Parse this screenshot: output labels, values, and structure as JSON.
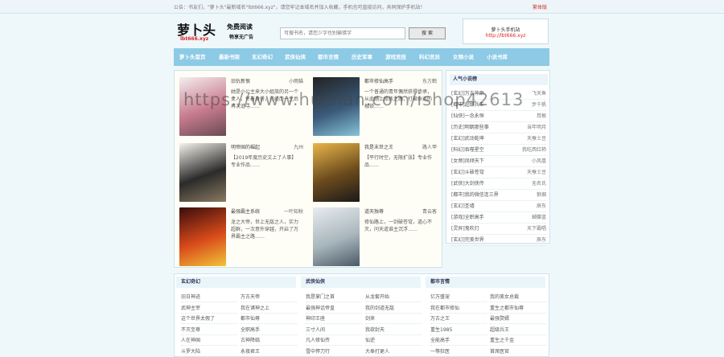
{
  "topbar": {
    "notice": "公告：书友们，\"萝卜头\"最新域名\"lbt666.xyz\"，请您牢记本域名并加入收藏，手机也可直接访问，共同保护手机站！",
    "trad_link": "繁体版"
  },
  "header": {
    "logo": "萝卜头",
    "logo_sub": "lbt666.xyz",
    "slogan_line1": "免费阅读",
    "slogan_line2": "畅享无广告",
    "search_placeholder": "可搜书名，请您少字也别输错字",
    "search_button": "搜 索",
    "mobile_line1": "萝卜头手机站",
    "mobile_line2": "http://lbt666.xyz"
  },
  "nav": [
    "萝卜头首页",
    "最新书架",
    "玄幻奇幻",
    "武侠仙侠",
    "都市言情",
    "历史军事",
    "游戏竞技",
    "科幻灵异",
    "女频小说",
    "小说书库"
  ],
  "books": [
    {
      "title": "旧仇新恨",
      "author": "小雨猫",
      "desc": "她是小公主来大小姐族的另一个女人，怀着身份，在经历一生后再次追寻……",
      "cover": [
        "#f4eef0",
        "#c77b8e",
        "#6a4a55"
      ]
    },
    {
      "title": "都市修仙高手",
      "author": "东方鹤",
      "desc": "一个普通的青年偶然获得传承，从此踏上修炼之路，打破命运的枷锁……",
      "cover": [
        "#222",
        "#3a5a7a",
        "#87c4d8"
      ]
    },
    {
      "title": "明帝国的崛起",
      "author": "九州",
      "desc": "【2019年度历史文上了人事】专业作品……",
      "cover": [
        "#f6f3ec",
        "#2b2b2b",
        "#8a7a60"
      ]
    },
    {
      "title": "我是末世之王",
      "author": "路人甲",
      "desc": "【平行时空，无限扩张】专业作品……",
      "cover": [
        "#e9b64a",
        "#6b4a1c",
        "#1a1a1a"
      ]
    },
    {
      "title": "最强霸主系统",
      "author": "一叶知秋",
      "desc": "龙之大帝，世上无敌之人，实力超群，一次意外穿越，开启了万界霸主之路……",
      "cover": [
        "#3a0c0c",
        "#d94b1a",
        "#f0c43a"
      ]
    },
    {
      "title": "道天独尊",
      "author": "青云客",
      "desc": "修仙路上，一剑破苍穹，道心不灭，问天道谁主沉浮……",
      "cover": [
        "#e8ecef",
        "#a9b6bd",
        "#4a5a66"
      ]
    }
  ],
  "sidebar": {
    "title": "人气小说榜",
    "items": [
      {
        "cat": "[玄幻]",
        "name": "万古神帝",
        "author": "飞天鱼"
      },
      {
        "cat": "[都市]",
        "name": "超级兵王",
        "author": "步千帆"
      },
      {
        "cat": "[仙侠]",
        "name": "一念永恒",
        "author": "耳根"
      },
      {
        "cat": "[历史]",
        "name": "明朝那些事",
        "author": "当年明月"
      },
      {
        "cat": "[玄幻]",
        "name": "武动乾坤",
        "author": "天蚕土豆"
      },
      {
        "cat": "[科幻]",
        "name": "吞噬星空",
        "author": "我吃西红柿"
      },
      {
        "cat": "[女频]",
        "name": "凤倾天下",
        "author": "小凤凰"
      },
      {
        "cat": "[玄幻]",
        "name": "斗破苍穹",
        "author": "天蚕土豆"
      },
      {
        "cat": "[武侠]",
        "name": "大剑侠传",
        "author": "无名氏"
      },
      {
        "cat": "[都市]",
        "name": "我的微信连三界",
        "author": "狼烟"
      },
      {
        "cat": "[玄幻]",
        "name": "圣墟",
        "author": "辰东"
      },
      {
        "cat": "[游戏]",
        "name": "全职高手",
        "author": "蝴蝶蓝"
      },
      {
        "cat": "[灵异]",
        "name": "鬼吹灯",
        "author": "天下霸唱"
      },
      {
        "cat": "[玄幻]",
        "name": "完美世界",
        "author": "辰东"
      }
    ]
  },
  "columns": [
    {
      "title": "玄幻奇幻",
      "rows": [
        [
          "旧日神迹",
          "万古天帝"
        ],
        [
          "武神主宰",
          "我在诸神之上"
        ],
        [
          "这个世界太假了",
          "都市仙尊"
        ],
        [
          "不灭至尊",
          "全职高手"
        ],
        [
          "人在神国",
          "古神降临"
        ],
        [
          "斗罗大陆",
          "永夜君王"
        ]
      ]
    },
    {
      "title": "武侠仙侠",
      "rows": [
        [
          "我是掌门之首",
          "从龙套开始"
        ],
        [
          "最强神话帝皇",
          "我的剑道无敌"
        ],
        [
          "神印王座",
          "剑来"
        ],
        [
          "三寸人间",
          "我欲封天"
        ],
        [
          "凡人修仙传",
          "仙逆"
        ],
        [
          "雪中悍刀行",
          "大奉打更人"
        ]
      ]
    },
    {
      "title": "都市言情",
      "rows": [
        [
          "亿万盛宠",
          "我的美女总裁"
        ],
        [
          "我在都市修仙",
          "重生之都市仙尊"
        ],
        [
          "万古之王",
          "最强赘婿"
        ],
        [
          "重生1985",
          "超级兵王"
        ],
        [
          "全能高手",
          "重生之千金"
        ],
        [
          "一等狂医",
          "首席医官"
        ]
      ]
    }
  ],
  "watermark": "https://www.huzhan.com/ishop42613"
}
